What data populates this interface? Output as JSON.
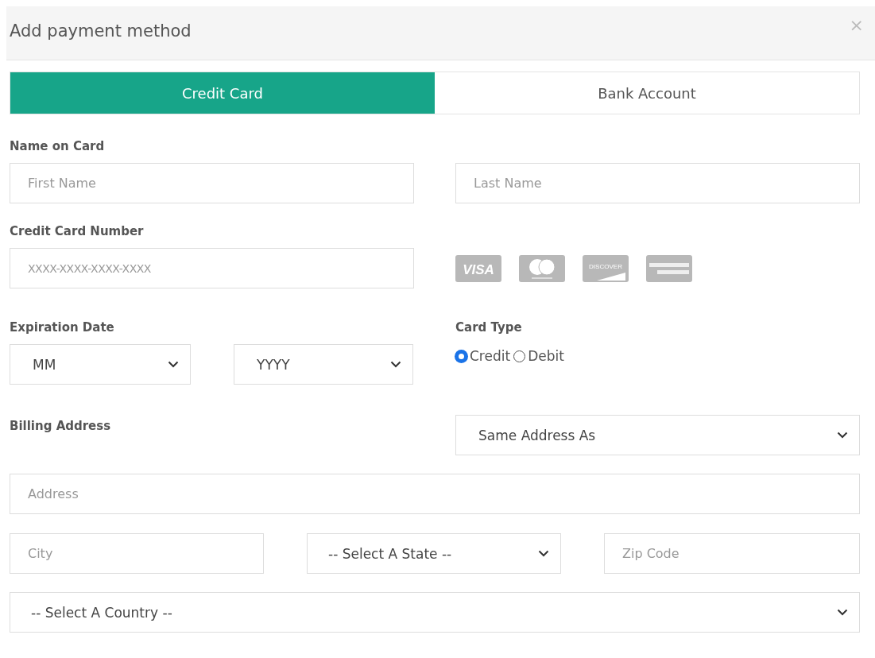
{
  "dialog": {
    "title": "Add payment method",
    "close": "×"
  },
  "tabs": [
    {
      "label": "Credit Card",
      "selected": true
    },
    {
      "label": "Bank Account",
      "selected": false
    }
  ],
  "name_on_card": {
    "label": "Name on Card",
    "fields": [
      {
        "placeholder": "First Name"
      },
      {
        "placeholder": "Last Name"
      }
    ]
  },
  "card_number": {
    "label": "Credit Card Number",
    "placeholder": "XXXX-XXXX-XXXX-XXXX",
    "card_logos": [
      {
        "kind": "visa",
        "text": "VISA"
      },
      {
        "kind": "mastercard"
      },
      {
        "kind": "discover",
        "text": "DISCOVER"
      },
      {
        "kind": "amex"
      }
    ]
  },
  "expiration": {
    "label": "Expiration Date",
    "selects": [
      "MM",
      "YYYY"
    ]
  },
  "card_type": {
    "label": "Card Type",
    "options": [
      {
        "label": "Credit",
        "selected": true
      },
      {
        "label": "Debit",
        "selected": false
      }
    ]
  },
  "billing": {
    "label": "Billing Address",
    "address_select": "Same Address As",
    "address": {
      "placeholder": "Address"
    },
    "city": {
      "placeholder": "City"
    },
    "state_select": "-- Select A State --",
    "zip": {
      "placeholder": "Zip Code"
    },
    "country_select": "-- Select A Country --"
  }
}
